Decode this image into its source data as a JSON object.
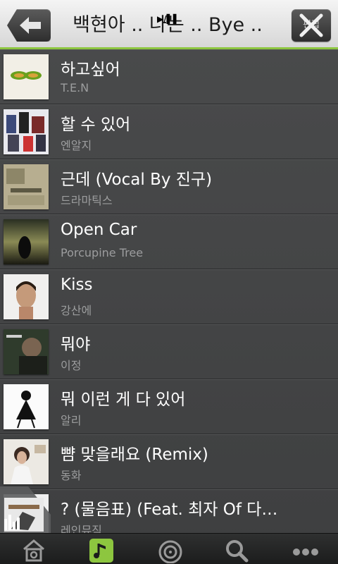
{
  "header": {
    "title": "백현아 .. 나는 .. Bye ..",
    "overlay_text": "▶/▌▌",
    "back_icon": "arrow-left-icon",
    "edit_label": "편집",
    "edit_icon": "close-x-icon"
  },
  "songs": [
    {
      "title": "하고싶어",
      "artist": "T.E.N"
    },
    {
      "title": "할 수 있어",
      "artist": "엔알지"
    },
    {
      "title": "근데 (Vocal By 진구)",
      "artist": "드라마틱스"
    },
    {
      "title": "Open Car",
      "artist": "Porcupine Tree"
    },
    {
      "title": "Kiss",
      "artist": "강산에"
    },
    {
      "title": "뭐야",
      "artist": "이정"
    },
    {
      "title": "뭐 이런 게 다 있어",
      "artist": "알리"
    },
    {
      "title": "뺨 맞을래요 (Remix)",
      "artist": "동화"
    },
    {
      "title": "? (물음표) (Feat. 최자 Of 다…",
      "artist": "레인뮤직"
    }
  ],
  "bottom_nav": [
    {
      "icon": "home-icon",
      "selected": false
    },
    {
      "icon": "music-note-icon",
      "selected": true
    },
    {
      "icon": "radio-waves-icon",
      "selected": false
    },
    {
      "icon": "search-icon",
      "selected": false
    },
    {
      "icon": "more-dots-icon",
      "selected": false
    }
  ],
  "colors": {
    "accent": "#8dc63f",
    "title_text": "#ffffff",
    "artist_text": "#9c9d9e"
  }
}
